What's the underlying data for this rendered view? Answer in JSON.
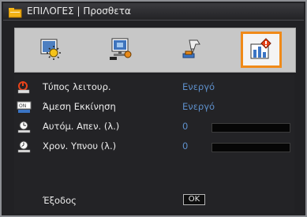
{
  "window": {
    "title": "ΕΠΙΛΟΓΕΣ | Προσθετα",
    "title_icon": "menu-folder-icon"
  },
  "tabs": [
    {
      "name": "image-tab",
      "icon": "sun-image-icon",
      "selected": false
    },
    {
      "name": "display-tab",
      "icon": "screen-settings-icon",
      "selected": false
    },
    {
      "name": "setup-tab",
      "icon": "hand-wrench-icon",
      "selected": false
    },
    {
      "name": "options-tab",
      "icon": "bar-chart-options-icon",
      "selected": true
    }
  ],
  "rows": [
    {
      "label": "Τύπος λειτουρ.",
      "value": "Ενεργό",
      "icon": "power-mode-icon"
    },
    {
      "label": "Άμεση Εκκίνηση",
      "value": "Ενεργό",
      "icon": "direct-power-on-icon"
    },
    {
      "label": "Αυτόμ. Απεν. (λ.)",
      "value": "0",
      "icon": "auto-power-off-timer-icon",
      "slider_level": 0
    },
    {
      "label": "Χρον. Υπνου (λ.)",
      "value": "0",
      "icon": "sleep-timer-icon",
      "slider_level": 0
    }
  ],
  "footer": {
    "exit_label": "Έξοδος",
    "ok_label": "OK"
  },
  "colors": {
    "accent_selected": "#f08a18",
    "value_text": "#5e8fca",
    "background": "#212124"
  }
}
